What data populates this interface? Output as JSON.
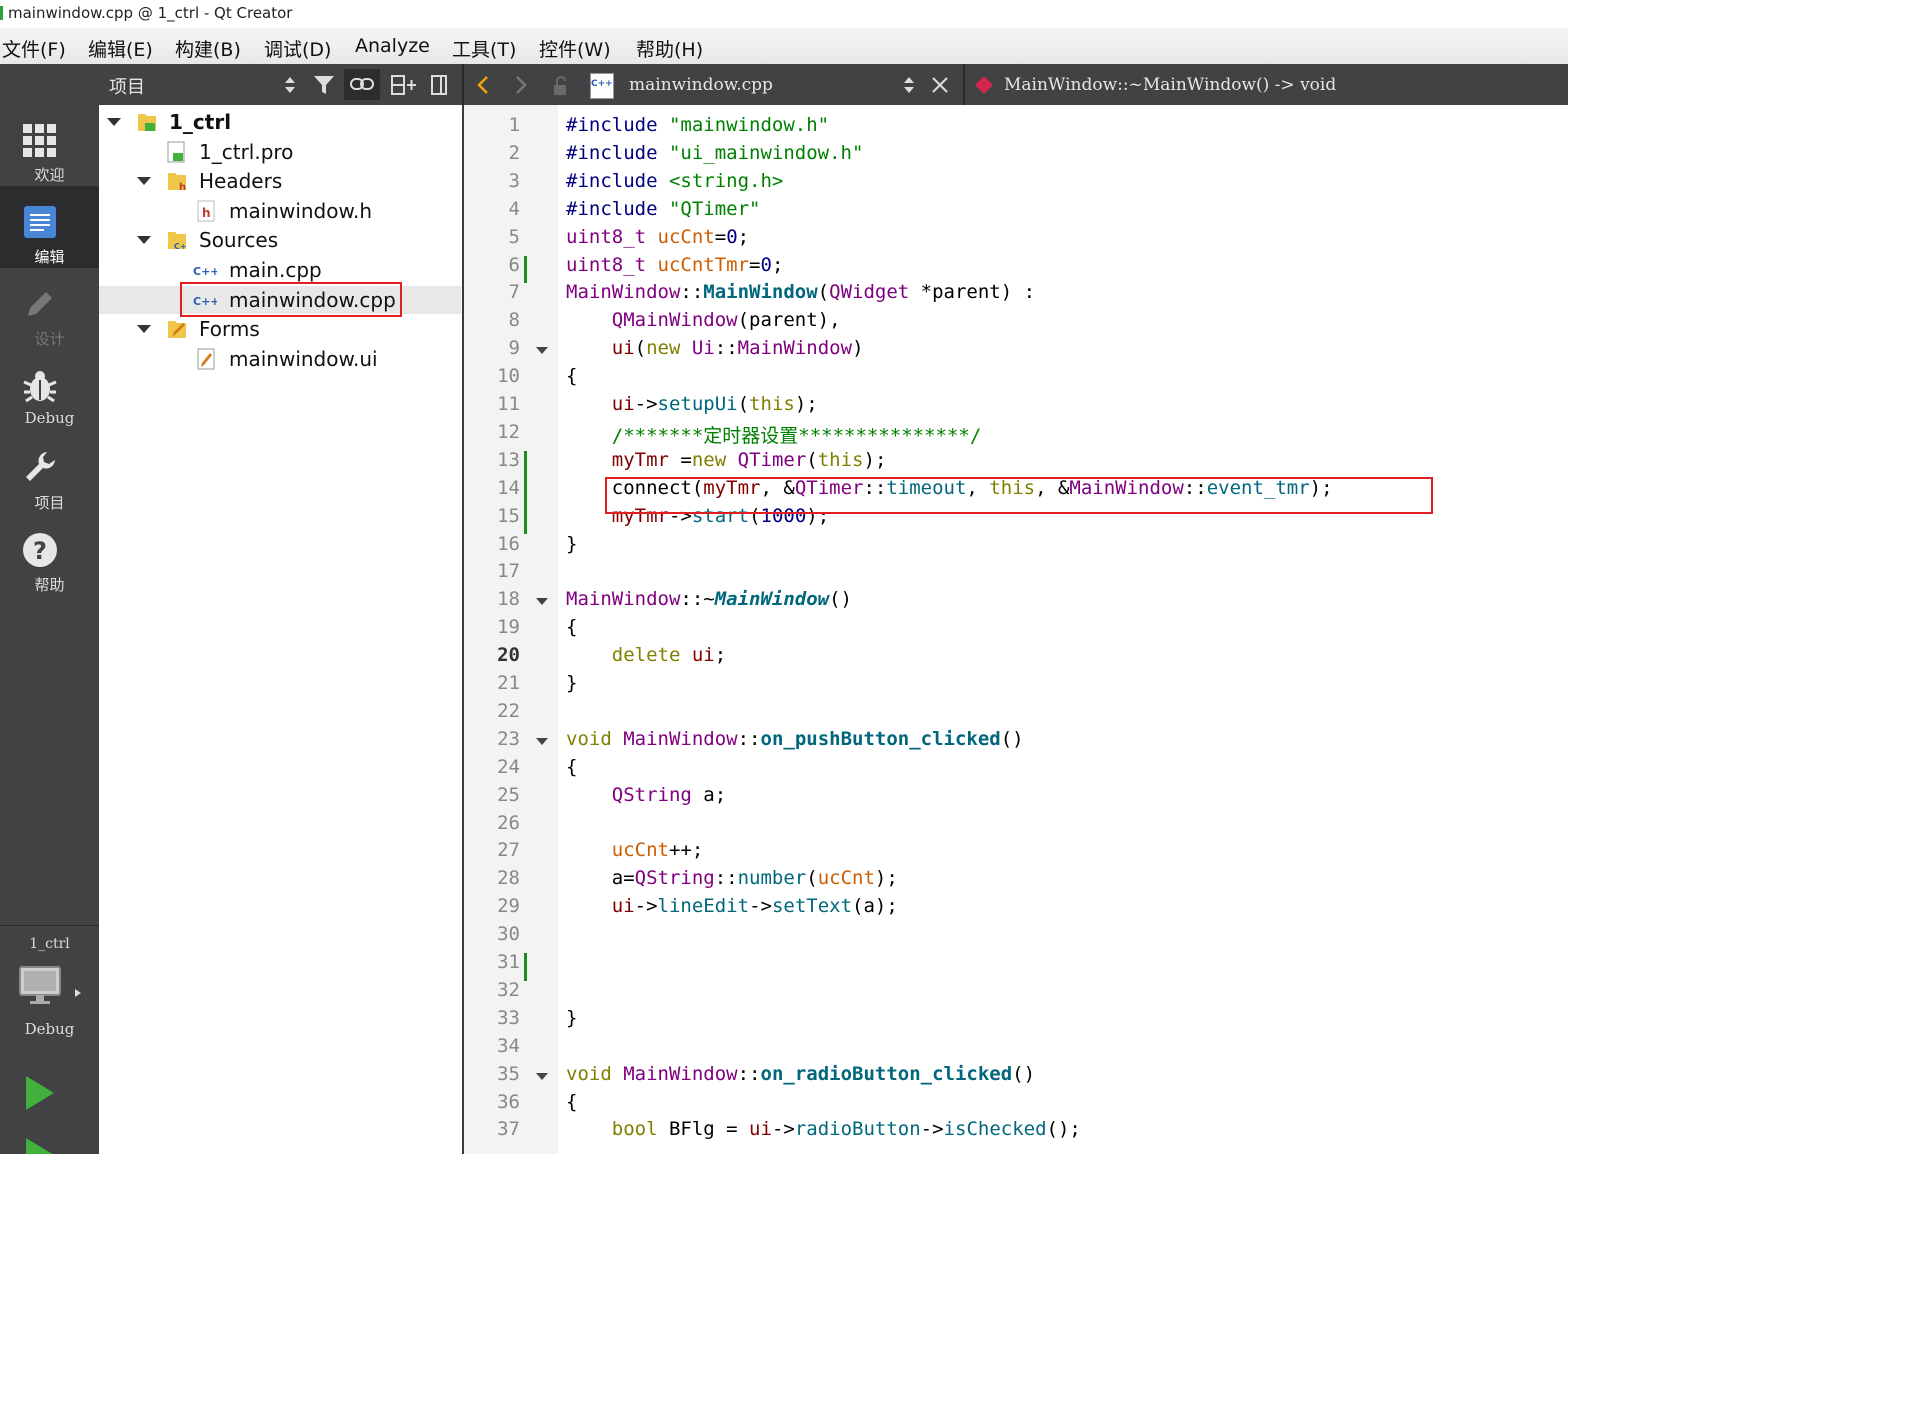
{
  "window": {
    "title": "mainwindow.cpp @ 1_ctrl - Qt Creator"
  },
  "menu": [
    "文件(F)",
    "编辑(E)",
    "构建(B)",
    "调试(D)",
    "Analyze",
    "工具(T)",
    "控件(W)",
    "帮助(H)"
  ],
  "sidebar": {
    "modes": [
      {
        "label": "欢迎",
        "icon": "grid-icon"
      },
      {
        "label": "编辑",
        "icon": "edit-document-icon"
      },
      {
        "label": "设计",
        "icon": "pencil-icon"
      },
      {
        "label": "Debug",
        "icon": "bug-icon"
      },
      {
        "label": "项目",
        "icon": "wrench-icon"
      },
      {
        "label": "帮助",
        "icon": "help-icon"
      }
    ],
    "target_project": "1_ctrl",
    "target_config": "Debug"
  },
  "toolbar": {
    "project_label": "项目",
    "file_name": "mainwindow.cpp",
    "file_badge": "C++",
    "symbol": "MainWindow::~MainWindow() -> void"
  },
  "tree": [
    {
      "name": "1_ctrl",
      "level": 0,
      "expanded": true,
      "bold": true
    },
    {
      "name": "1_ctrl.pro",
      "level": 1
    },
    {
      "name": "Headers",
      "level": 1,
      "expanded": true
    },
    {
      "name": "mainwindow.h",
      "level": 2
    },
    {
      "name": "Sources",
      "level": 1,
      "expanded": true
    },
    {
      "name": "main.cpp",
      "level": 2
    },
    {
      "name": "mainwindow.cpp",
      "level": 2,
      "selected": true
    },
    {
      "name": "Forms",
      "level": 1,
      "expanded": true
    },
    {
      "name": "mainwindow.ui",
      "level": 2
    }
  ],
  "editor": {
    "current_line": 20,
    "lines": [
      "#include \"mainwindow.h\"",
      "#include \"ui_mainwindow.h\"",
      "#include <string.h>",
      "#include \"QTimer\"",
      "uint8_t ucCnt=0;",
      "uint8_t ucCntTmr=0;",
      "MainWindow::MainWindow(QWidget *parent) :",
      "    QMainWindow(parent),",
      "    ui(new Ui::MainWindow)",
      "{",
      "    ui->setupUi(this);",
      "    /*******定时器设置***************/",
      "    myTmr =new QTimer(this);",
      "    connect(myTmr, &QTimer::timeout, this, &MainWindow::event_tmr);",
      "    myTmr->start(1000);",
      "}",
      "",
      "MainWindow::~MainWindow()",
      "{",
      "    delete ui;",
      "}",
      "",
      "void MainWindow::on_pushButton_clicked()",
      "{",
      "    QString a;",
      "",
      "    ucCnt++;",
      "    a=QString::number(ucCnt);",
      "    ui->lineEdit->setText(a);",
      "",
      "",
      "",
      "}",
      "",
      "void MainWindow::on_radioButton_clicked()",
      "{",
      "    bool BFlg = ui->radioButton->isChecked();"
    ]
  }
}
